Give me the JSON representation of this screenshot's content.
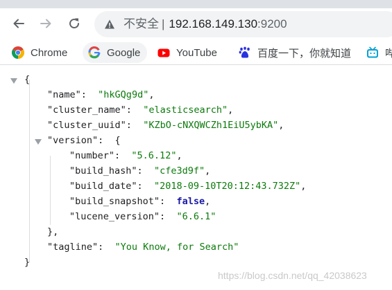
{
  "browser": {
    "address_bar": {
      "security_label": "不安全",
      "separator": "|",
      "host": "192.168.149.130",
      "port": ":9200"
    },
    "bookmarks": [
      {
        "label": "Chrome",
        "icon": "chrome-icon"
      },
      {
        "label": "Google",
        "icon": "google-icon"
      },
      {
        "label": "YouTube",
        "icon": "youtube-icon"
      },
      {
        "label": "百度一下，你就知道",
        "icon": "baidu-icon"
      },
      {
        "label": "哔",
        "icon": "bilibili-icon"
      }
    ]
  },
  "json_view": {
    "open_brace": "{",
    "close_brace": "}",
    "name": {
      "key": "\"name\"",
      "value": "\"hkGQg9d\""
    },
    "cluster_name": {
      "key": "\"cluster_name\"",
      "value": "\"elasticsearch\""
    },
    "cluster_uuid": {
      "key": "\"cluster_uuid\"",
      "value": "\"KZbO-cNXQWCZh1EiU5ybKA\""
    },
    "version": {
      "key": "\"version\"",
      "number": {
        "key": "\"number\"",
        "value": "\"5.6.12\""
      },
      "build_hash": {
        "key": "\"build_hash\"",
        "value": "\"cfe3d9f\""
      },
      "build_date": {
        "key": "\"build_date\"",
        "value": "\"2018-09-10T20:12:43.732Z\""
      },
      "build_snapshot": {
        "key": "\"build_snapshot\"",
        "value": "false"
      },
      "lucene_version": {
        "key": "\"lucene_version\"",
        "value": "\"6.6.1\""
      },
      "close": "},"
    },
    "tagline": {
      "key": "\"tagline\"",
      "value": "\"You Know, for Search\""
    }
  },
  "watermark": "https://blog.csdn.net/qq_42038623",
  "colors": {
    "string": "#0b7a0b",
    "boolean": "#1a1aa6",
    "youtube": "#ff0000",
    "baidu": "#2932e1",
    "bilibili": "#00a1d6"
  }
}
